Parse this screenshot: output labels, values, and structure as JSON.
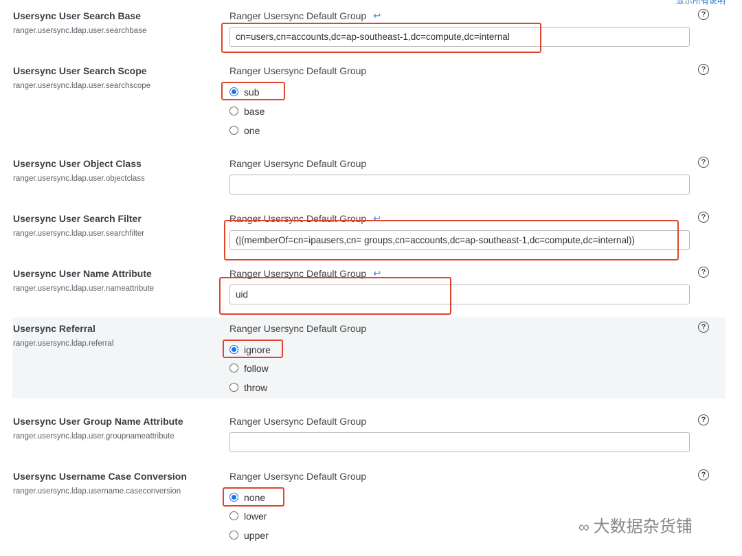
{
  "top_link": "显示所有说明",
  "group_name": "Ranger Usersync Default Group",
  "help_icon": "?",
  "undo_icon": "↩",
  "rows": {
    "search_base": {
      "title": "Usersync User Search Base",
      "key": "ranger.usersync.ldap.user.searchbase",
      "value": "cn=users,cn=accounts,dc=ap-southeast-1,dc=compute,dc=internal"
    },
    "search_scope": {
      "title": "Usersync User Search Scope",
      "key": "ranger.usersync.ldap.user.searchscope",
      "options": [
        "sub",
        "base",
        "one"
      ],
      "selected": "sub"
    },
    "object_class": {
      "title": "Usersync User Object Class",
      "key": "ranger.usersync.ldap.user.objectclass",
      "value": ""
    },
    "search_filter": {
      "title": "Usersync User Search Filter",
      "key": "ranger.usersync.ldap.user.searchfilter",
      "value": "(|(memberOf=cn=ipausers,cn= groups,cn=accounts,dc=ap-southeast-1,dc=compute,dc=internal))"
    },
    "name_attribute": {
      "title": "Usersync User Name Attribute",
      "key": "ranger.usersync.ldap.user.nameattribute",
      "value": "uid"
    },
    "referral": {
      "title": "Usersync Referral",
      "key": "ranger.usersync.ldap.referral",
      "options": [
        "ignore",
        "follow",
        "throw"
      ],
      "selected": "ignore"
    },
    "group_name_attribute": {
      "title": "Usersync User Group Name Attribute",
      "key": "ranger.usersync.ldap.user.groupnameattribute",
      "value": ""
    },
    "case_conversion": {
      "title": "Usersync Username Case Conversion",
      "key": "ranger.usersync.ldap.username.caseconversion",
      "options": [
        "none",
        "lower",
        "upper"
      ],
      "selected": "none"
    }
  },
  "watermark": "大数据杂货铺",
  "colors": {
    "accent": "#1a73e8",
    "highlight": "#e0452b",
    "shaded_row": "#f4f5f6"
  }
}
